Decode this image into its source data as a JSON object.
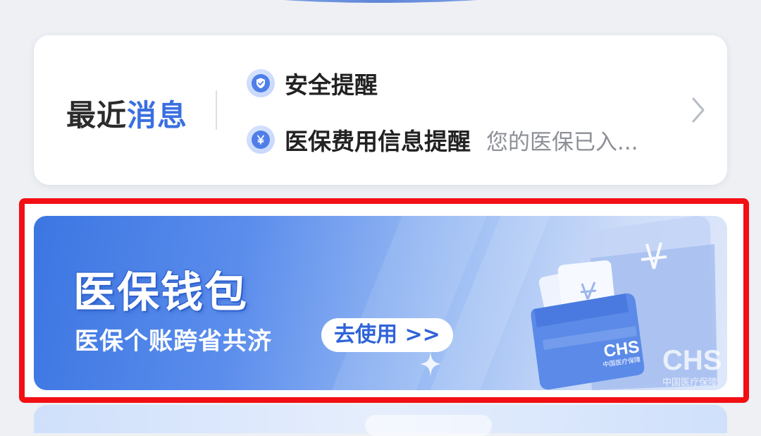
{
  "recent_messages": {
    "title_part1": "最近",
    "title_part2": "消息",
    "items": [
      {
        "icon": "shield-check-icon",
        "label": "安全提醒",
        "preview": ""
      },
      {
        "icon": "yen-coin-icon",
        "label": "医保费用信息提醒",
        "preview": "您的医保已入..."
      }
    ]
  },
  "wallet_banner": {
    "title": "医保钱包",
    "subtitle": "医保个账跨省共济",
    "button_label": "去使用 >>",
    "card_logo": "CHS",
    "card_caption": "中国医疗保障"
  },
  "colors": {
    "accent": "#3a6fe0",
    "highlight_border": "#f20f14",
    "banner_start": "#3c76e2",
    "banner_end": "#dfe8fb"
  }
}
